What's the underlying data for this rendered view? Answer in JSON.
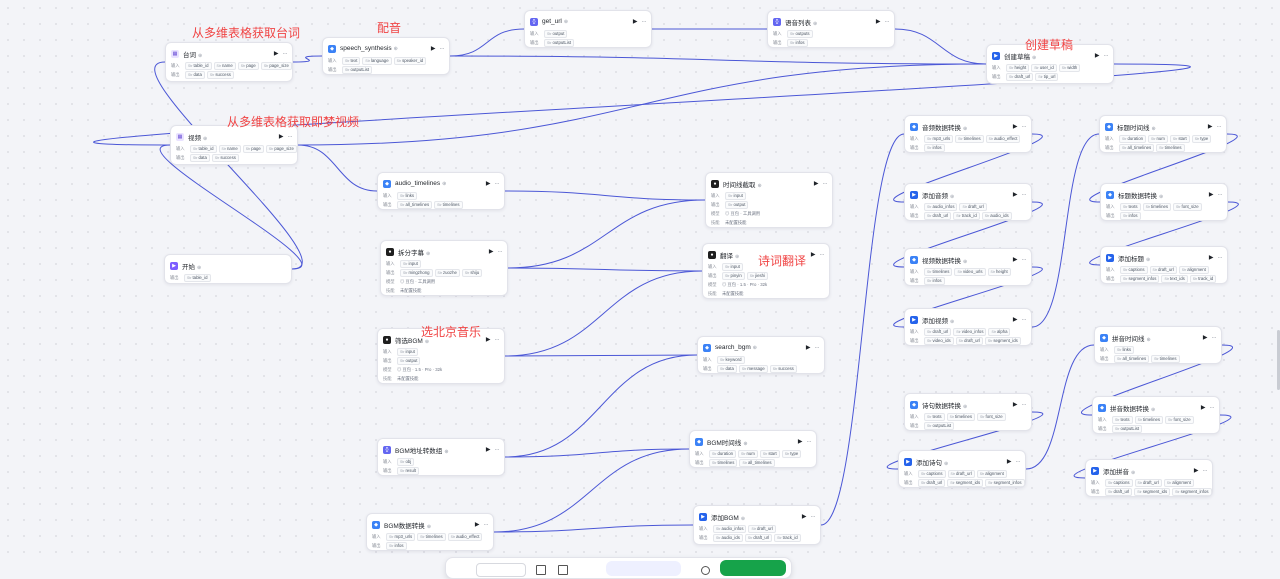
{
  "annotations": {
    "get_lines": "从多维表格获取台词",
    "dubbing": "配音",
    "get_video": "从多维表格获取即梦视频",
    "create_draft": "创建草稿",
    "poem_translate": "诗词翻译",
    "select_music": "选北京音乐"
  },
  "labels": {
    "input": "输入",
    "output": "输出",
    "model": "模型",
    "skill": "技能",
    "no_skill": "未配置技能"
  },
  "nodes": {
    "taici": {
      "title": "台词",
      "in": [
        "table_id",
        "name",
        "page",
        "page_size"
      ],
      "out": [
        "data",
        "success"
      ]
    },
    "speech": {
      "title": "speech_synthesis",
      "in": [
        "text",
        "language",
        "speaker_id"
      ],
      "out": [
        "outputList"
      ]
    },
    "geturl": {
      "title": "get_url",
      "in": [
        "output"
      ],
      "out": [
        "outputList"
      ]
    },
    "yylb": {
      "title": "语音列表",
      "in": [
        "outputs"
      ],
      "out": [
        "infos"
      ]
    },
    "cjcg": {
      "title": "创建草稿",
      "in": [
        "height",
        "user_id",
        "width"
      ],
      "out": [
        "draft_url",
        "tip_url"
      ]
    },
    "video": {
      "title": "视频",
      "in": [
        "table_id",
        "name",
        "page",
        "page_size"
      ],
      "out": [
        "data",
        "success"
      ]
    },
    "start": {
      "title": "开始",
      "out": [
        "table_id"
      ]
    },
    "audiotl": {
      "title": "audio_timelines",
      "in": [
        "links"
      ],
      "out": [
        "all_timelines",
        "timelines"
      ]
    },
    "sjxjq": {
      "title": "时间线截取",
      "in": [
        "input"
      ],
      "out": [
        "output"
      ],
      "model": "豆包 · 工具调用",
      "skill": "未配置技能"
    },
    "cfzm": {
      "title": "拆分字幕",
      "in": [
        "input"
      ],
      "out": [
        "mingzhong",
        "zuozhe",
        "shiju"
      ],
      "model": "豆包 · 工具调用",
      "skill": "未配置技能"
    },
    "fanyi": {
      "title": "翻译",
      "in": [
        "input"
      ],
      "out": [
        "pinyin",
        "jieshi"
      ],
      "model": "豆包 · 1.5 · Pro · 32k",
      "skill": "未配置技能"
    },
    "sxbgm": {
      "title": "筛选BGM",
      "in": [
        "input"
      ],
      "out": [
        "output"
      ],
      "model": "豆包 · 1.5 · Pro · 32k",
      "skill": "未配置技能"
    },
    "searchbgm": {
      "title": "search_bgm",
      "in": [
        "keyword"
      ],
      "out": [
        "data",
        "message",
        "success"
      ]
    },
    "bgmdz": {
      "title": "BGM地址转数组",
      "in": [
        "obj"
      ],
      "out": [
        "result"
      ]
    },
    "bgmsjx": {
      "title": "BGM时间线",
      "in": [
        "duration",
        "num",
        "start",
        "type"
      ],
      "out": [
        "timelines",
        "all_timelines"
      ]
    },
    "bgmsjzh": {
      "title": "BGM数据转换",
      "in": [
        "mp3_urls",
        "timelines",
        "audio_effect"
      ],
      "out": [
        "infos"
      ]
    },
    "tjbgm": {
      "title": "添加BGM",
      "in": [
        "audio_infos",
        "draft_url"
      ],
      "out": [
        "audio_ids",
        "draft_url",
        "track_id"
      ]
    },
    "ypsjzh": {
      "title": "音频数据转换",
      "in": [
        "mp3_urls",
        "timelines",
        "audio_effect"
      ],
      "out": [
        "infos"
      ]
    },
    "tjyp": {
      "title": "添加音频",
      "in": [
        "audio_infos",
        "draft_url"
      ],
      "out": [
        "draft_url",
        "track_id",
        "audio_ids"
      ]
    },
    "spsjzh": {
      "title": "视频数据转换",
      "in": [
        "timelines",
        "video_urls",
        "height"
      ],
      "out": [
        "infos"
      ]
    },
    "tjsp": {
      "title": "添加视频",
      "in": [
        "draft_url",
        "video_infos",
        "alpha"
      ],
      "out": [
        "video_ids",
        "draft_url",
        "segment_ids"
      ]
    },
    "scsjzh": {
      "title": "诗句数据转换",
      "in": [
        "texts",
        "timelines",
        "font_size"
      ],
      "out": [
        "outputList"
      ]
    },
    "tjsj": {
      "title": "添加诗句",
      "in": [
        "captions",
        "draft_url",
        "alignment"
      ],
      "out": [
        "draft_url",
        "segment_ids",
        "segment_infos"
      ]
    },
    "btsjx": {
      "title": "标题时间线",
      "in": [
        "duration",
        "num",
        "start",
        "type"
      ],
      "out": [
        "all_timelines",
        "timelines"
      ]
    },
    "btsjzh": {
      "title": "标题数据转换",
      "in": [
        "texts",
        "timelines",
        "font_size"
      ],
      "out": [
        "infos"
      ]
    },
    "tjbt": {
      "title": "添加标题",
      "in": [
        "captions",
        "draft_url",
        "alignment"
      ],
      "out": [
        "segment_infos",
        "text_ids",
        "track_id"
      ]
    },
    "pysjx": {
      "title": "拼音时间线",
      "in": [
        "links"
      ],
      "out": [
        "all_timelines",
        "timelines"
      ]
    },
    "pysjzh": {
      "title": "拼音数据转换",
      "in": [
        "texts",
        "timelines",
        "font_size"
      ],
      "out": [
        "outputList"
      ]
    },
    "tjpy": {
      "title": "添加拼音",
      "in": [
        "captions",
        "draft_url",
        "alignment"
      ],
      "out": [
        "draft_url",
        "segment_ids",
        "segment_infos"
      ]
    }
  }
}
